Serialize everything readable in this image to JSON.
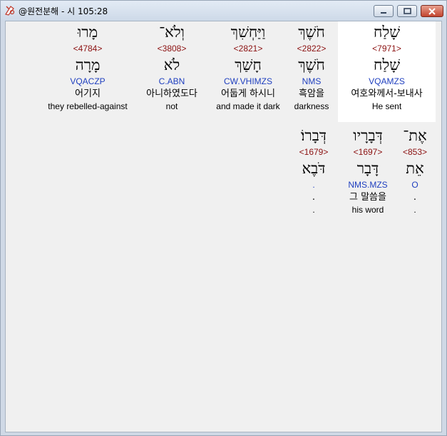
{
  "window": {
    "title": "@원전분해 - 시 105:28",
    "buttons": {
      "minimize": "—",
      "maximize": "□",
      "close": "✕"
    }
  },
  "rows": [
    [
      {
        "hebrew": "שָׁלַח",
        "strong": "<7971>",
        "lemma": "שָׁלַח",
        "morph": "VQAMZS",
        "korean": "여호와께서-보내사",
        "english": "He sent",
        "highlight": true
      },
      {
        "hebrew": "חֹשֶׁךְ",
        "strong": "<2822>",
        "lemma": "חֹשֶׁךְ",
        "morph": "NMS",
        "korean": "흑암을",
        "english": "darkness",
        "highlight": false
      },
      {
        "hebrew": "וַיַּחְשִׁךְ",
        "strong": "<2821>",
        "lemma": "חָשַׁךְ",
        "morph": "CW.VHIMZS",
        "korean": "어둡게 하시니",
        "english": "and made it dark",
        "highlight": false
      },
      {
        "hebrew": "וְלֹא־",
        "strong": "<3808>",
        "lemma": "לֹא",
        "morph": "C.ABN",
        "korean": "아니하였도다",
        "english": "not",
        "highlight": false
      },
      {
        "hebrew": "מָרוּ",
        "strong": "<4784>",
        "lemma": "מָרָה",
        "morph": "VQACZP",
        "korean": "어기지",
        "english": "they rebelled-against",
        "highlight": false
      }
    ],
    [
      {
        "hebrew": "אֶת־",
        "strong": "<853>",
        "lemma": "אֵת",
        "morph": "O",
        "korean": ".",
        "english": ".",
        "highlight": false
      },
      {
        "hebrew": "דְּבָרָיו",
        "strong": "<1697>",
        "lemma": "דָּבָר",
        "morph": "NMS.MZS",
        "korean": "그 말씀을",
        "english": "his word",
        "highlight": false
      },
      {
        "hebrew": "דְּבָרוֹ׃",
        "strong": "<1679>",
        "lemma": "דֹּבֶא",
        "morph": ".",
        "korean": ".",
        "english": ".",
        "highlight": false
      }
    ]
  ]
}
